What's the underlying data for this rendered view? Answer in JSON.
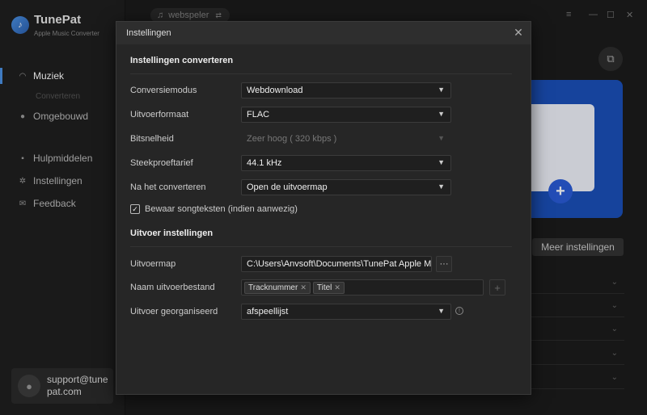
{
  "app": {
    "name": "TunePat",
    "subtitle": "Apple Music Converter",
    "logo_icon": "music-note-icon",
    "source_pill": "webspeler",
    "source_switch": "⇄",
    "window_controls": [
      "≡",
      "—",
      "☐",
      "✕"
    ]
  },
  "sidebar": {
    "items": [
      {
        "label": "Muziek",
        "icon": "headphones-icon",
        "glyph": "🎧",
        "active": true
      },
      {
        "label": "Omgebouwd",
        "icon": "clock-icon",
        "glyph": "●",
        "active": false
      },
      {
        "label": "Hulpmiddelen",
        "icon": "toolbox-icon",
        "glyph": "▪",
        "active": false
      },
      {
        "label": "Instellingen",
        "icon": "gear-icon",
        "glyph": "✲",
        "active": false
      },
      {
        "label": "Feedback",
        "icon": "mail-icon",
        "glyph": "✉",
        "active": false
      }
    ],
    "sub_item": "Converteren",
    "account": {
      "email": "support@tunepat.com",
      "avatar_glyph": "👤"
    }
  },
  "background": {
    "more_settings": "Meer instellingen",
    "icon_glyph": "⧉",
    "promo_plus": "+"
  },
  "dialog": {
    "title": "Instellingen",
    "close": "✕",
    "section_convert": "Instellingen converteren",
    "section_output": "Uitvoer instellingen",
    "fields": {
      "mode": {
        "label": "Conversiemodus",
        "value": "Webdownload"
      },
      "format": {
        "label": "Uitvoerformaat",
        "value": "FLAC"
      },
      "bitrate": {
        "label": "Bitsnelheid",
        "value": "Zeer hoog ( 320 kbps )",
        "disabled": true
      },
      "samplerate": {
        "label": "Steekproeftarief",
        "value": "44.1 kHz"
      },
      "after": {
        "label": "Na het converteren",
        "value": "Open de uitvoermap"
      }
    },
    "keep_lyrics": {
      "label": "Bewaar songteksten (indien aanwezig)",
      "checked": true,
      "mark": "✓"
    },
    "output_folder": {
      "label": "Uitvoermap",
      "value": "C:\\Users\\Anvsoft\\Documents\\TunePat Apple Music",
      "browse": "···"
    },
    "file_name": {
      "label": "Naam uitvoerbestand",
      "tags": [
        "Tracknummer",
        "Titel"
      ],
      "add": "+"
    },
    "organized": {
      "label": "Uitvoer georganiseerd",
      "value": "afspeellijst",
      "info": "!"
    }
  }
}
